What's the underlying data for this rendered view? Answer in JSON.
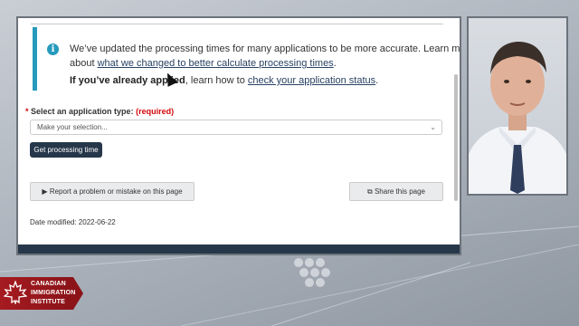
{
  "notice": {
    "line1": "We’ve updated the processing times for many applications to be more accurate. Learn more",
    "line2_prefix": "about ",
    "line2_link": "what we changed to better calculate processing times",
    "line2_suffix": ".",
    "line3_bold": "If you’ve already applied",
    "line3_mid": ", learn how to ",
    "line3_link": "check your application status",
    "line3_suffix": "."
  },
  "form": {
    "label_star": "*",
    "label": "Select an application type:",
    "required": "(required)",
    "select_value": "Make your selection...",
    "submit_label": "Get processing time"
  },
  "actions": {
    "report_label": "Report a problem or mistake on this page",
    "share_label": "Share this page"
  },
  "meta": {
    "date_modified": "Date modified: 2022-06-22"
  },
  "brand": {
    "line1": "CANADIAN",
    "line2": "IMMIGRATION",
    "line3": "INSTITUTE"
  },
  "colors": {
    "info_blue": "#269abc",
    "link": "#284162",
    "required_red": "#d3080c",
    "primary_button": "#26374a",
    "logo_red": "#a51b20"
  },
  "icons": [
    "info-icon",
    "caret-right-icon",
    "share-icon",
    "chevron-down-icon",
    "maple-leaf-icon"
  ]
}
